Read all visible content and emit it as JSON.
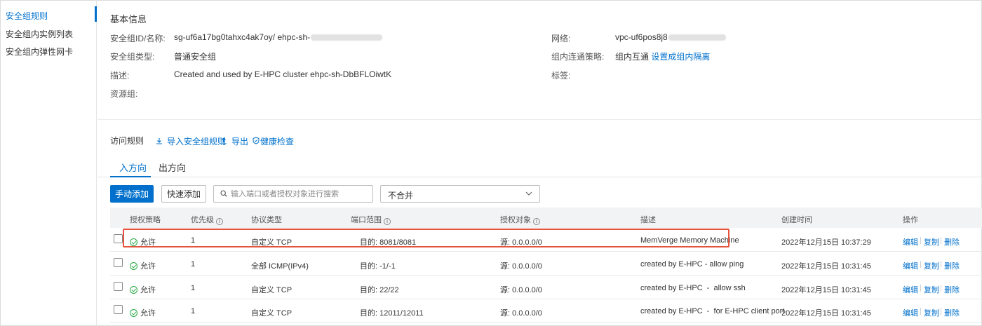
{
  "sidebar": {
    "items": [
      {
        "label": "安全组规则",
        "active": true
      },
      {
        "label": "安全组内实例列表",
        "active": false
      },
      {
        "label": "安全组内弹性网卡",
        "active": false
      }
    ]
  },
  "basic_info": {
    "title": "基本信息",
    "id_label": "安全组ID/名称:",
    "id_value": "sg-uf6a17bg0tahxc4ak7oy/ ehpc-sh-",
    "type_label": "安全组类型:",
    "type_value": "普通安全组",
    "desc_label": "描述:",
    "desc_value": "Created and used by E-HPC cluster ehpc-sh-DbBFLOiwtK",
    "rg_label": "资源组:",
    "network_label": "网络:",
    "network_value": "vpc-uf6pos8j8",
    "policy_label": "组内连通策略:",
    "policy_value": "组内互通",
    "policy_link": "设置成组内隔离",
    "tags_label": "标签:"
  },
  "access_rules": {
    "title": "访问规则",
    "import_label": "导入安全组规则",
    "export_label": "导出",
    "health_label": "健康检查",
    "tabs": [
      "入方向",
      "出方向"
    ],
    "add_manual": "手动添加",
    "add_quick": "快速添加",
    "search_placeholder": "输入端口或者授权对象进行搜索",
    "merge_select": "不合并"
  },
  "colors": {
    "accent": "#0070cc",
    "allow_green": "#28a745",
    "highlight_red": "#e5533d"
  },
  "table": {
    "headers": {
      "policy": "授权策略",
      "priority": "优先级",
      "protocol": "协议类型",
      "port": "端口范围",
      "source": "授权对象",
      "desc": "描述",
      "created": "创建时间",
      "ops": "操作"
    },
    "rows": [
      {
        "policy": "允许",
        "priority": "1",
        "protocol": "自定义 TCP",
        "port": "目的: 8081/8081",
        "source": "源: 0.0.0.0/0",
        "desc": "MemVerge Memory Machine",
        "created": "2022年12月15日 10:37:29",
        "highlighted": true
      },
      {
        "policy": "允许",
        "priority": "1",
        "protocol": "全部 ICMP(IPv4)",
        "port": "目的: -1/-1",
        "source": "源: 0.0.0.0/0",
        "desc": "created by E-HPC - allow ping",
        "created": "2022年12月15日 10:31:45",
        "highlighted": false
      },
      {
        "policy": "允许",
        "priority": "1",
        "protocol": "自定义 TCP",
        "port": "目的: 22/22",
        "source": "源: 0.0.0.0/0",
        "desc": "created by E-HPC  -  allow ssh",
        "created": "2022年12月15日 10:31:45",
        "highlighted": false
      },
      {
        "policy": "允许",
        "priority": "1",
        "protocol": "自定义 TCP",
        "port": "目的: 12011/12011",
        "source": "源: 0.0.0.0/0",
        "desc": "created by E-HPC  -  for E-HPC client port",
        "created": "2022年12月15日 10:31:45",
        "highlighted": false
      }
    ],
    "ops": {
      "edit": "编辑",
      "copy": "复制",
      "delete": "删除"
    }
  }
}
